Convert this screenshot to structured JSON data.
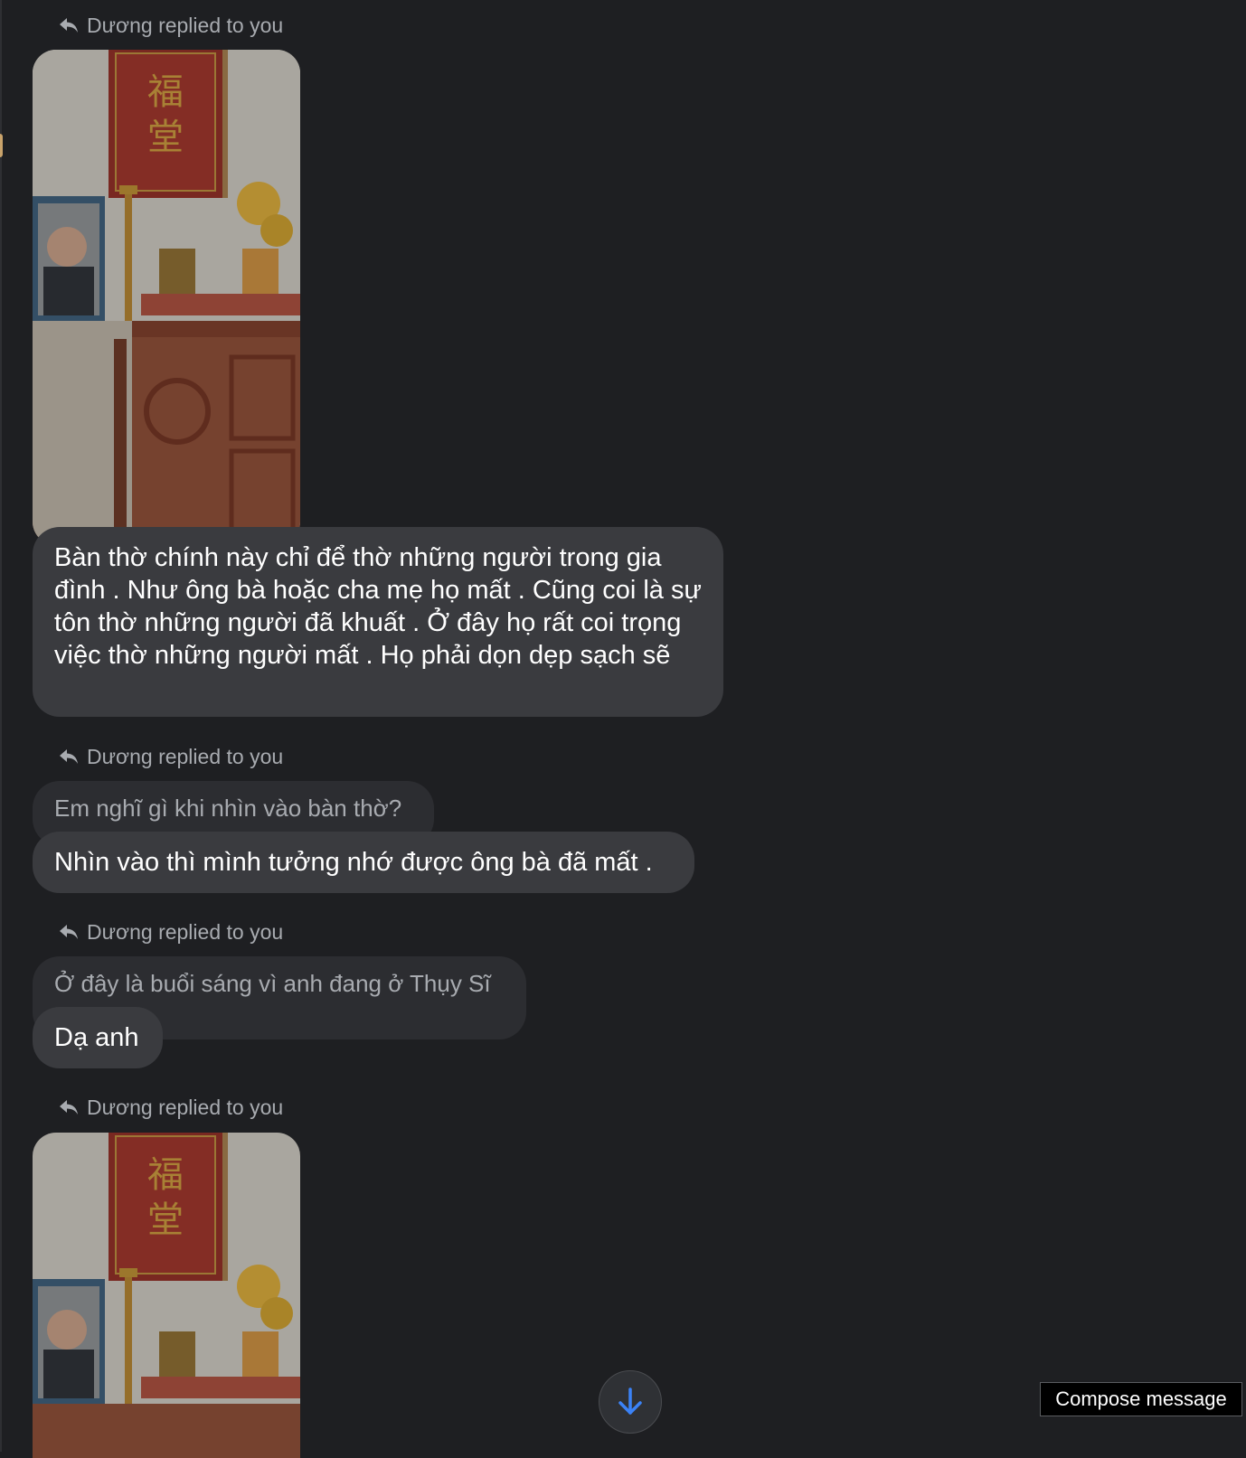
{
  "conversation": {
    "messages": [
      {
        "type": "reply-label",
        "text": "Dương replied to you"
      },
      {
        "type": "image",
        "description_icon": "altar-photo"
      },
      {
        "type": "text",
        "text": "Bàn thờ chính này chỉ để thờ những người trong gia đình . Như ông bà hoặc cha mẹ họ mất . Cũng coi là sự tôn thờ những người đã khuất . Ở đây họ rất coi trọng việc thờ những người mất . Họ phải dọn dẹp sạch sẽ"
      },
      {
        "type": "reply-label",
        "text": "Dương replied to you"
      },
      {
        "type": "quote",
        "text": "Em nghĩ gì khi nhìn vào bàn thờ?"
      },
      {
        "type": "text",
        "text": "Nhìn vào thì mình tưởng nhớ được ông bà đã mất ."
      },
      {
        "type": "reply-label",
        "text": "Dương replied to you"
      },
      {
        "type": "quote",
        "text": "Ở đây là buổi sáng vì anh đang ở Thụy Sĩ"
      },
      {
        "type": "text",
        "text": "Dạ anh"
      },
      {
        "type": "reply-label",
        "text": "Dương replied to you"
      },
      {
        "type": "image",
        "description_icon": "altar-photo"
      }
    ]
  },
  "controls": {
    "scroll_down_icon": "arrow-down-icon",
    "compose_tooltip": "Compose message"
  },
  "colors": {
    "background": "#1e1f22",
    "bubble": "#3a3b3f",
    "quote_bubble": "#2c2d31",
    "muted_text": "#a8abb0",
    "accent_blue": "#3b82f6"
  }
}
